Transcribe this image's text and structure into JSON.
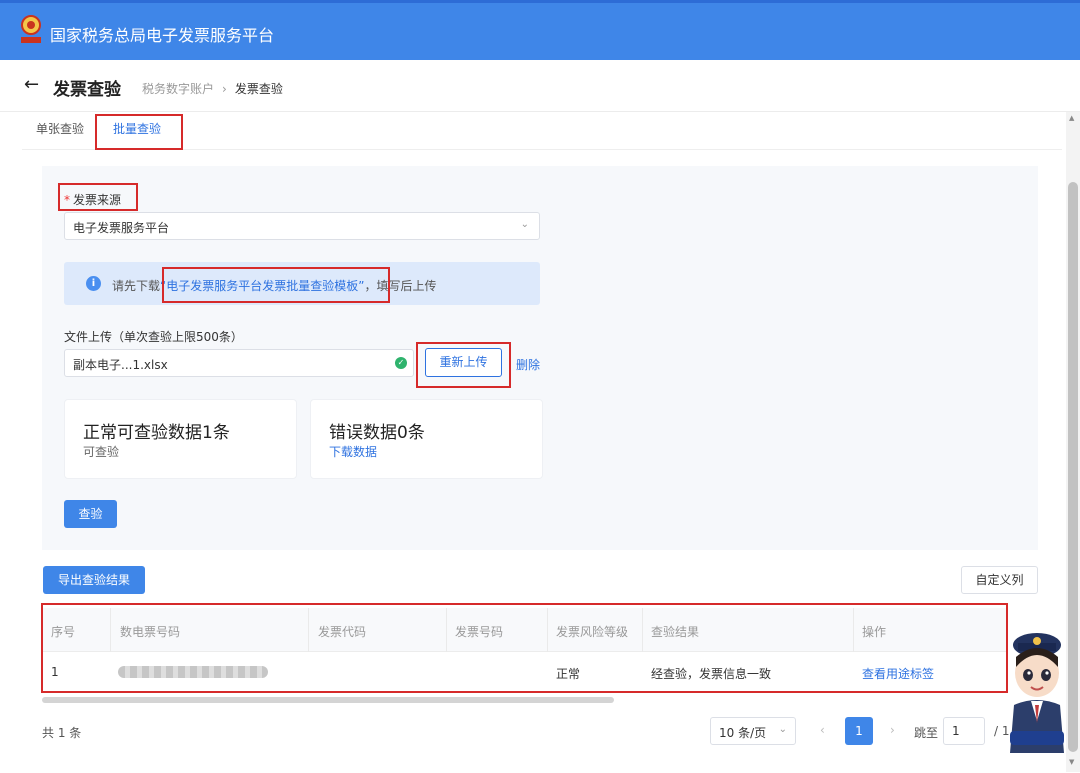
{
  "app": {
    "title": "国家税务总局电子发票服务平台"
  },
  "header": {
    "back_icon": "arrow-left-icon",
    "title": "发票查验",
    "breadcrumb": [
      "税务数字账户",
      "发票查验"
    ]
  },
  "tabs": [
    {
      "label": "单张查验",
      "active": false
    },
    {
      "label": "批量查验",
      "active": true
    }
  ],
  "form": {
    "source_required_mark": "*",
    "source_label": "发票来源",
    "source_value": "电子发票服务平台",
    "alert_prefix": "请先下载",
    "alert_link": "“电子发票服务平台发票批量查验模板”",
    "alert_suffix": "，填写后上传",
    "upload_label": "文件上传（单次查验上限500条）",
    "file_name": "副本电子...1.xlsx",
    "reupload_label": "重新上传",
    "delete_label": "删除",
    "card_valid_title": "正常可查验数据1条",
    "card_valid_sub": "可查验",
    "card_error_title": "错误数据0条",
    "card_error_sub": "下载数据",
    "verify_button": "查验"
  },
  "toolbar": {
    "export_label": "导出查验结果",
    "custom_columns_label": "自定义列"
  },
  "table": {
    "columns": [
      "序号",
      "数电票号码",
      "发票代码",
      "发票号码",
      "发票风险等级",
      "查验结果",
      "操作"
    ],
    "rows": [
      {
        "index": "1",
        "number_blurred": true,
        "code": "",
        "invoice_no": "",
        "risk": "正常",
        "result": "经查验，发票信息一致",
        "action": "查看用途标签"
      }
    ]
  },
  "pagination": {
    "total": "共 1 条",
    "page_size": "10 条/页",
    "prev": "‹",
    "current": "1",
    "next": "›",
    "jump_label": "跳至",
    "jump_value": "1",
    "total_pages": "/ 1"
  },
  "colors": {
    "primary": "#3f86e8",
    "link": "#2e72e0",
    "highlight_box": "#d62a2a",
    "success": "#2fb36d"
  }
}
